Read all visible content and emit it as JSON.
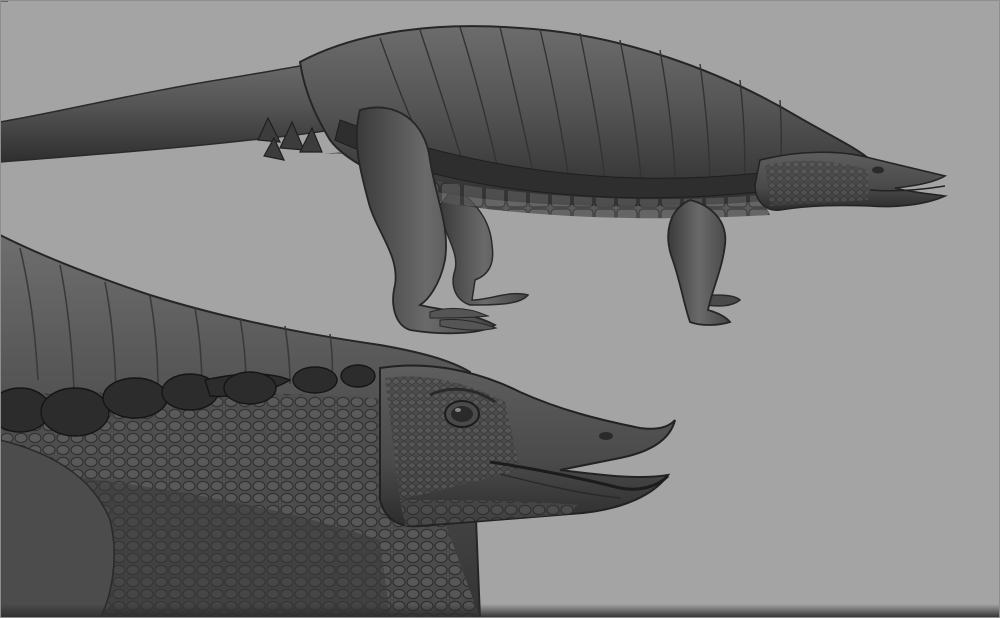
{
  "scene": {
    "subject": "sculpted-reptile-creature",
    "background_color": "#a4a4a4",
    "mesh_base_color": "#5a5a5a",
    "mesh_dark_color": "#2a2a2a",
    "mesh_light_color": "#8a8a8a",
    "accent_color": "#d03a2a"
  }
}
